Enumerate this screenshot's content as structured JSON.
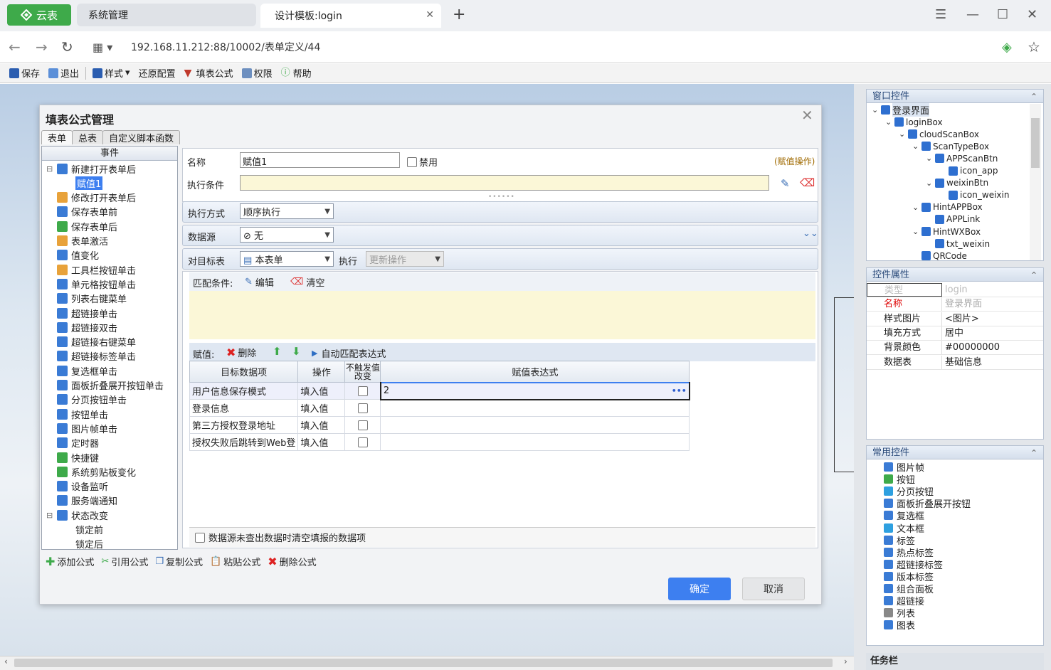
{
  "browser": {
    "brand": "云表",
    "tabs": [
      {
        "label": "系统管理"
      },
      {
        "label": "设计模板:login"
      }
    ],
    "url": "192.168.11.212:88/10002/表单定义/44"
  },
  "toolbar": {
    "save": "保存",
    "exit": "退出",
    "style": "样式",
    "restore": "还原配置",
    "formula": "填表公式",
    "perm": "权限",
    "help": "帮助"
  },
  "dialog": {
    "title": "填表公式管理",
    "tabs": [
      "表单",
      "总表",
      "自定义脚本函数"
    ],
    "events_header": "事件",
    "events": [
      "新建打开表单后",
      "赋值1",
      "修改打开表单后",
      "保存表单前",
      "保存表单后",
      "表单激活",
      "值变化",
      "工具栏按钮单击",
      "单元格按钮单击",
      "列表右键菜单",
      "超链接单击",
      "超链接双击",
      "超链接右键菜单",
      "超链接标签单击",
      "复选框单击",
      "面板折叠展开按钮单击",
      "分页按钮单击",
      "按钮单击",
      "图片帧单击",
      "定时器",
      "快捷键",
      "系统剪贴板变化",
      "设备监听",
      "服务端通知",
      "状态改变",
      "锁定前",
      "锁定后"
    ],
    "name_label": "名称",
    "name_value": "赋值1",
    "disable_label": "禁用",
    "op_type": "(赋值操作)",
    "cond_label": "执行条件",
    "exec_label": "执行方式",
    "exec_value": "顺序执行",
    "ds_label": "数据源",
    "ds_value": "无",
    "target_label": "对目标表",
    "target_value": "本表单",
    "exec2_label": "执行",
    "exec2_value": "更新操作",
    "match_label": "匹配条件:",
    "edit": "编辑",
    "clear": "清空",
    "assign_label": "赋值:",
    "delete": "删除",
    "auto_match": "自动匹配表达式",
    "grid": {
      "headers": [
        "目标数据项",
        "操作",
        "不触发值改变",
        "赋值表达式"
      ],
      "rows": [
        {
          "item": "用户信息保存模式",
          "op": "填入值",
          "expr": "2"
        },
        {
          "item": "登录信息",
          "op": "填入值",
          "expr": ""
        },
        {
          "item": "第三方授权登录地址",
          "op": "填入值",
          "expr": ""
        },
        {
          "item": "授权失败后跳转到Web登",
          "op": "填入值",
          "expr": ""
        }
      ]
    },
    "clear_empty": "数据源未查出数据时清空填报的数据项",
    "footer": [
      "添加公式",
      "引用公式",
      "复制公式",
      "粘贴公式",
      "删除公式"
    ],
    "ok": "确定",
    "cancel": "取消"
  },
  "window_controls": {
    "header": "窗口控件",
    "tree": [
      "登录界面",
      "loginBox",
      "cloudScanBox",
      "ScanTypeBox",
      "APPScanBtn",
      "icon_app",
      "weixinBtn",
      "icon_weixin",
      "HintAPPBox",
      "APPLink",
      "HintWXBox",
      "txt_weixin",
      "QRCode"
    ]
  },
  "props": {
    "header": "控件属性",
    "rows": [
      {
        "k": "类型",
        "v": "login"
      },
      {
        "k": "名称",
        "v": "登录界面"
      },
      {
        "k": "样式图片",
        "v": "<图片>"
      },
      {
        "k": "填充方式",
        "v": "居中"
      },
      {
        "k": "背景颜色",
        "v": "#00000000"
      },
      {
        "k": "数据表",
        "v": "基础信息"
      }
    ]
  },
  "common": {
    "header": "常用控件",
    "items": [
      "图片帧",
      "按钮",
      "分页按钮",
      "面板折叠展开按钮",
      "复选框",
      "文本框",
      "标签",
      "热点标签",
      "超链接标签",
      "版本标签",
      "组合面板",
      "超链接",
      "列表",
      "图表"
    ]
  },
  "taskbar": "任务栏"
}
